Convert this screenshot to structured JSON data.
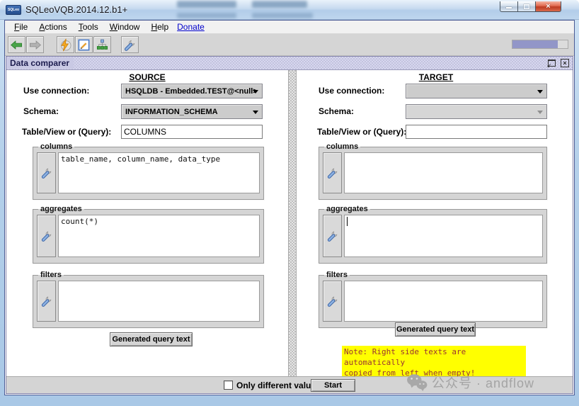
{
  "titlebar": {
    "title": "SQLeoVQB.2014.12.b1+",
    "icon_label": "SQLeo"
  },
  "menubar": {
    "items": [
      {
        "m": "F",
        "rest": "ile"
      },
      {
        "m": "A",
        "rest": "ctions"
      },
      {
        "m": "T",
        "rest": "ools"
      },
      {
        "m": "W",
        "rest": "indow"
      },
      {
        "m": "H",
        "rest": "elp"
      }
    ],
    "donate_label": "Donate"
  },
  "toolbar": {
    "progress_percent": 82
  },
  "data_comparer": {
    "frame_title": "Data comparer",
    "source": {
      "header": "SOURCE",
      "use_connection_label": "Use connection:",
      "use_connection_value": "HSQLDB - Embedded.TEST@<null>",
      "schema_label": "Schema:",
      "schema_value": "INFORMATION_SCHEMA",
      "table_label": "Table/View or (Query):",
      "table_value": "COLUMNS",
      "columns_label": "columns",
      "columns_value": "table_name, column_name, data_type",
      "aggregates_label": "aggregates",
      "aggregates_value": "count(*)",
      "filters_label": "filters",
      "filters_value": "",
      "generated_button": "Generated query text"
    },
    "target": {
      "header": "TARGET",
      "use_connection_label": "Use connection:",
      "use_connection_value": "",
      "schema_label": "Schema:",
      "schema_value": "",
      "table_label": "Table/View or (Query):",
      "table_value": "",
      "columns_label": "columns",
      "columns_value": "",
      "aggregates_label": "aggregates",
      "aggregates_value": "",
      "filters_label": "filters",
      "filters_value": "",
      "generated_button": "Generated query text",
      "note_line1": "Note: Right side texts are automatically",
      "note_line2": "copied from left when empty!"
    },
    "footer": {
      "only_different_label": "Only different values",
      "start_button": "Start"
    }
  },
  "watermark": {
    "text": "公众号 · andflow"
  },
  "colors": {
    "note_bg": "#ffff00",
    "note_text": "#993333",
    "progress_fill": "#9296c8",
    "frame_title_bg": "#c9c9e4",
    "close_button": "#bc3b22"
  }
}
